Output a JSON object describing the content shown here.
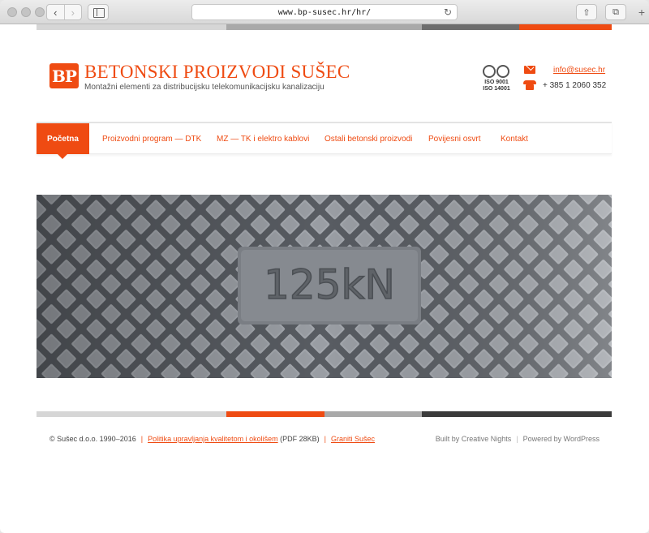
{
  "browser": {
    "url": "www.bp-susec.hr/hr/",
    "back_glyph": "‹",
    "forward_glyph": "›",
    "reload_glyph": "↻",
    "share_glyph": "⇧",
    "tabs_glyph": "⧉",
    "new_tab_glyph": "+"
  },
  "header": {
    "logo_text": "BP",
    "title": "BETONSKI PROIZVODI SUŠEC",
    "tagline": "Montažni elementi za distribucijsku telekomunikacijsku kanalizaciju",
    "iso_line1": "ISO 9001",
    "iso_line2": "ISO 14001",
    "email": "info@susec.hr",
    "phone": "+ 385 1 2060 352"
  },
  "nav": {
    "items": [
      {
        "label": "Početna",
        "active": true
      },
      {
        "label": "Proizvodni program — DTK",
        "active": false
      },
      {
        "label": "MZ — TK i elektro kablovi",
        "active": false
      },
      {
        "label": "Ostali betonski proizvodi",
        "active": false
      },
      {
        "label": "Povijesni osvrt",
        "active": false
      },
      {
        "label": "Kontakt",
        "active": false
      }
    ]
  },
  "hero": {
    "plate_text": "125kN"
  },
  "footer": {
    "copyright": "© Sušec d.o.o. 1990–2016",
    "policy_link": "Politika upravljanja kvalitetom i okolišem",
    "policy_suffix": " (PDF 28KB)",
    "granite_link": "Graniti Sušec",
    "built_by": "Built by Creative Nights",
    "powered_by": "Powered by WordPress"
  },
  "colors": {
    "accent": "#ef4b12",
    "text": "#444444"
  }
}
